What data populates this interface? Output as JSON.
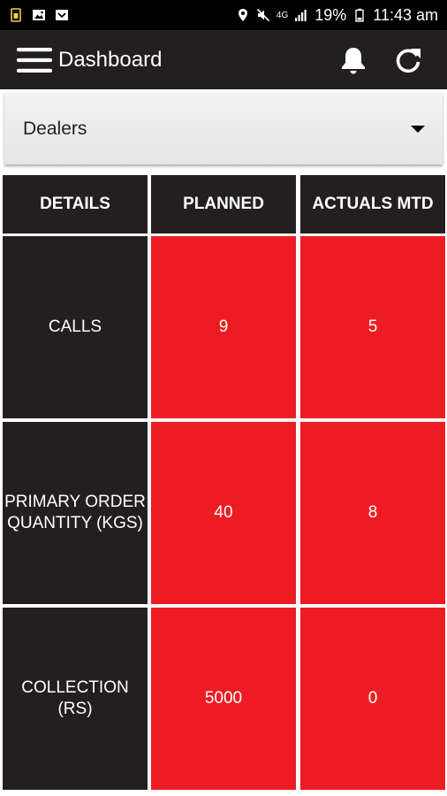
{
  "status_bar": {
    "battery": "19%",
    "time": "11:43 am",
    "network": "4G"
  },
  "app_bar": {
    "title": "Dashboard",
    "icons": [
      "menu-icon",
      "bell-icon",
      "refresh-icon"
    ]
  },
  "dropdown": {
    "selected": "Dealers"
  },
  "table": {
    "headers": [
      "DETAILS",
      "PLANNED",
      "ACTUALS MTD"
    ],
    "rows": [
      {
        "details": "CALLS",
        "planned": "9",
        "actual": "5"
      },
      {
        "details": "PRIMARY ORDER QUANTITY (KGS)",
        "planned": "40",
        "actual": "8"
      },
      {
        "details": "COLLECTION (RS)",
        "planned": "5000",
        "actual": "0"
      }
    ]
  },
  "colors": {
    "dark": "#231f20",
    "accent": "#ed1c24",
    "status_bar": "#000000"
  }
}
